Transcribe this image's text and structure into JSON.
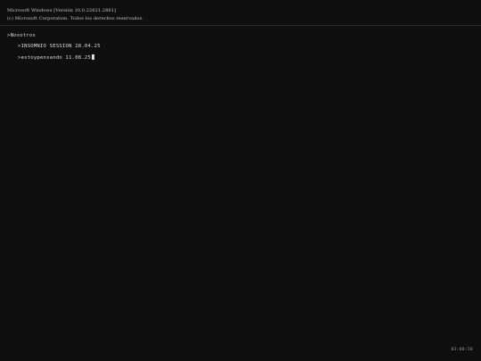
{
  "header": {
    "version_line": "Microsoft Windows [Versión 10.0.22621.2861]",
    "copyright_line": "(c) Microsoft Corporation. Todos los derechos reservados."
  },
  "terminal": {
    "root_prompt": ">Nosotros",
    "session_line": ">INSOMNIO SESSION 28.04.25",
    "input_line": ">estoypensando 11.08.25"
  },
  "footer": {
    "code": "03:00:50"
  }
}
